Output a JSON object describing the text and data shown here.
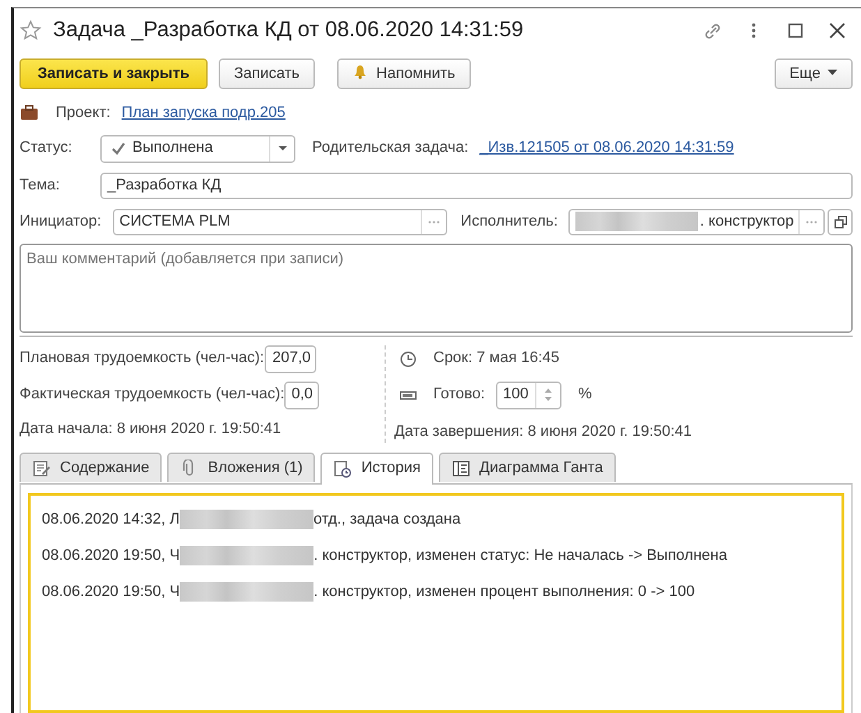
{
  "window": {
    "title": "Задача _Разработка КД от 08.06.2020 14:31:59",
    "favorite": false
  },
  "toolbar": {
    "buttons": [
      {
        "label": "Записать и закрыть",
        "kind": "primary"
      },
      {
        "label": "Записать",
        "kind": "plain"
      },
      {
        "label": "Напомнить",
        "kind": "bell"
      }
    ],
    "more": "Еще"
  },
  "project": {
    "label": "Проект:",
    "link": "План запуска подр.205"
  },
  "status": {
    "label": "Статус:",
    "value": "Выполнена"
  },
  "parent": {
    "label": "Родительская задача:",
    "link": "_Изв.121505 от 08.06.2020 14:31:59"
  },
  "subject": {
    "label": "Тема:",
    "value": "_Разработка КД"
  },
  "initiator": {
    "label": "Инициатор:",
    "value": "СИСТЕМА PLM"
  },
  "executor": {
    "label": "Исполнитель:",
    "redacted": true,
    "value": ". конструктор"
  },
  "comment": {
    "placeholder": "Ваш комментарий (добавляется при записи)"
  },
  "planned": {
    "label": "Плановая трудоемкость (чел-час):",
    "value": "207,0"
  },
  "actual": {
    "label": "Фактическая трудоемкость (чел-час):",
    "value": "0,0"
  },
  "start": "Дата начала: 8 июня 2020 г. 19:50:41",
  "deadline": "Срок: 7 мая 16:45",
  "ready": {
    "label": "Готово:",
    "value": "100",
    "unit": "%"
  },
  "finish": "Дата завершения: 8 июня 2020 г. 19:50:41",
  "tabs": [
    {
      "label": "Содержание",
      "kind": "edit",
      "selected": false
    },
    {
      "label": "Вложения (1)",
      "kind": "clip",
      "selected": false
    },
    {
      "label": "История",
      "kind": "history",
      "selected": true
    },
    {
      "label": "Диаграмма Ганта",
      "kind": "gantt",
      "selected": false
    }
  ],
  "history": [
    {
      "before": "08.06.2020 14:32, Л",
      "redacted": true,
      "after": "отд., задача создана"
    },
    {
      "before": "08.06.2020 19:50, Ч",
      "redacted": true,
      "after": ". конструктор, изменен статус: Не началась -> Выполнена"
    },
    {
      "before": "08.06.2020 19:50, Ч",
      "redacted": true,
      "after": ". конструктор, изменен процент выполнения: 0 -> 100"
    }
  ]
}
